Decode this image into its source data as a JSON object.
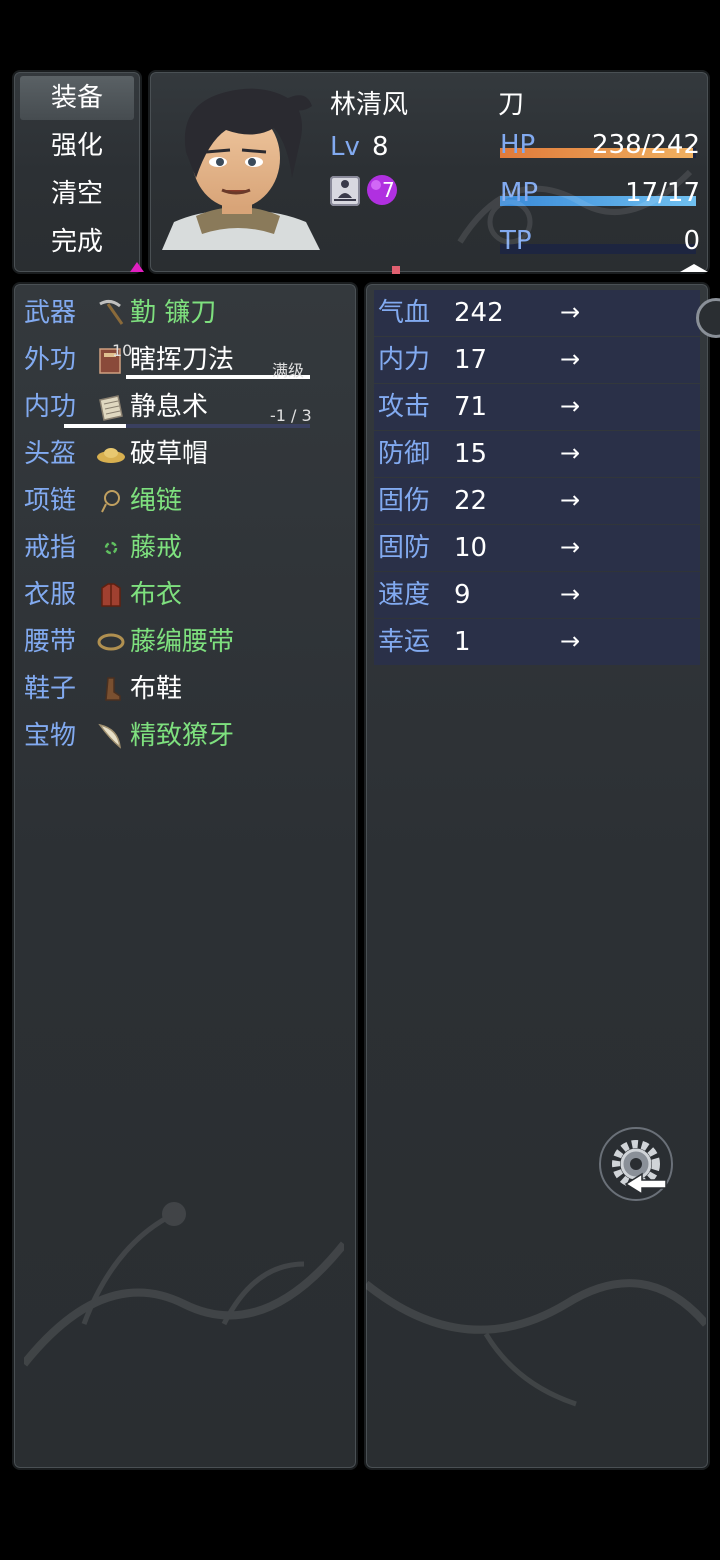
{
  "menu": {
    "items": [
      "装备",
      "强化",
      "清空",
      "完成"
    ],
    "selected": 0
  },
  "actor": {
    "name": "林清风",
    "class": "刀",
    "level_label": "Lv",
    "level": "8",
    "points": "7",
    "hp_label": "HP",
    "hp_value": "238/242",
    "hp_ratio": 0.983,
    "mp_label": "MP",
    "mp_value": "17/17",
    "mp_ratio": 1.0,
    "tp_label": "TP",
    "tp_value": "0",
    "tp_ratio": 0.0
  },
  "skills": {
    "waigong_level": "10",
    "waigong_max": "满级",
    "neigong_progress": "-1 / 3"
  },
  "equipment": [
    {
      "slot": "武器",
      "name": "勤 镰刀",
      "icon": "sickle-icon",
      "color": "green"
    },
    {
      "slot": "外功",
      "name": "瞎挥刀法",
      "icon": "book-icon",
      "color": "white"
    },
    {
      "slot": "内功",
      "name": "静息术",
      "icon": "scroll-icon",
      "color": "white"
    },
    {
      "slot": "头盔",
      "name": "破草帽",
      "icon": "straw-hat-icon",
      "color": "white"
    },
    {
      "slot": "项链",
      "name": "绳链",
      "icon": "rope-necklace-icon",
      "color": "green"
    },
    {
      "slot": "戒指",
      "name": "藤戒",
      "icon": "vine-ring-icon",
      "color": "green"
    },
    {
      "slot": "衣服",
      "name": "布衣",
      "icon": "cloth-armor-icon",
      "color": "green"
    },
    {
      "slot": "腰带",
      "name": "藤编腰带",
      "icon": "belt-icon",
      "color": "green"
    },
    {
      "slot": "鞋子",
      "name": "布鞋",
      "icon": "boot-icon",
      "color": "white"
    },
    {
      "slot": "宝物",
      "name": "精致獠牙",
      "icon": "fang-icon",
      "color": "green"
    }
  ],
  "params": [
    {
      "label": "气血",
      "value": "242",
      "arrow": "→"
    },
    {
      "label": "内力",
      "value": "17",
      "arrow": "→"
    },
    {
      "label": "攻击",
      "value": "71",
      "arrow": "→"
    },
    {
      "label": "防御",
      "value": "15",
      "arrow": "→"
    },
    {
      "label": "固伤",
      "value": "22",
      "arrow": "→"
    },
    {
      "label": "固防",
      "value": "10",
      "arrow": "→"
    },
    {
      "label": "速度",
      "value": "9",
      "arrow": "→"
    },
    {
      "label": "幸运",
      "value": "1",
      "arrow": "→"
    }
  ],
  "colors": {
    "system_blue": "#82aaf0",
    "equip_green": "#7ee07e",
    "hp_gradient": [
      "#e07a3a",
      "#f0b060"
    ],
    "mp_gradient": [
      "#3a8ad8",
      "#70c0f0"
    ]
  }
}
